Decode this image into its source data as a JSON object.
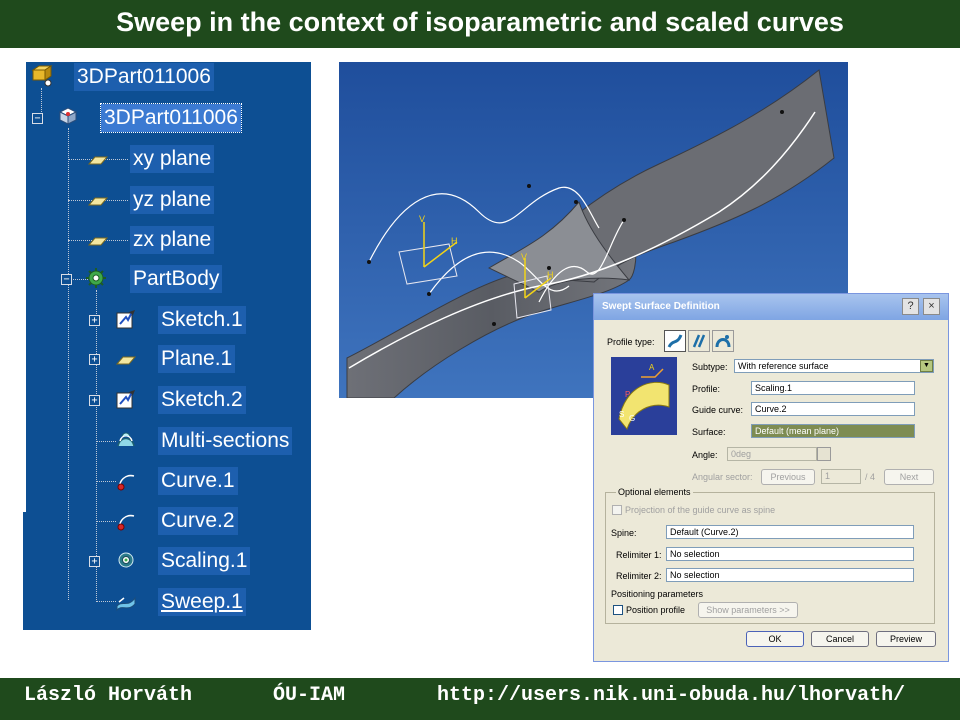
{
  "title": "Sweep in the context of isoparametric and scaled curves",
  "footer": {
    "author": "László Horváth",
    "institute": "ÓU-IAM",
    "url": "http://users.nik.uni-obuda.hu/lhorvath/"
  },
  "tree": {
    "root": "3DPart011006",
    "part": "3DPart011006",
    "xy": "xy plane",
    "yz": "yz plane",
    "zx": "zx plane",
    "body": "PartBody",
    "sketch1": "Sketch.1",
    "plane1": "Plane.1",
    "sketch2": "Sketch.2",
    "multi": "Multi-sections",
    "curve1": "Curve.1",
    "curve2": "Curve.2",
    "scaling1": "Scaling.1",
    "sweep1": "Sweep.1"
  },
  "viewport": {
    "axis_v": "V",
    "axis_h": "H"
  },
  "dialog": {
    "title": "Swept Surface Definition",
    "help_glyph": "?",
    "close_glyph": "×",
    "profile_type_label": "Profile type:",
    "subtype_label": "Subtype:",
    "subtype_value": "With reference surface",
    "profile_label": "Profile:",
    "profile_value": "Scaling.1",
    "guide_label": "Guide curve:",
    "guide_value": "Curve.2",
    "surface_label": "Surface:",
    "surface_value": "Default (mean plane)",
    "angle_label": "Angle:",
    "angle_value": "0deg",
    "sector_label": "Angular sector:",
    "previous": "Previous",
    "sector_value": "1",
    "sector_total": "/ 4",
    "next": "Next",
    "optional_label": "Optional elements",
    "projection_label": "Projection of the guide curve as spine",
    "spine_label": "Spine:",
    "spine_value": "Default (Curve.2)",
    "relim1_label": "Relimiter 1:",
    "relim1_value": "No selection",
    "relim2_label": "Relimiter 2:",
    "relim2_value": "No selection",
    "positioning_label": "Positioning parameters",
    "position_profile": "Position profile",
    "show_params": "Show parameters >>",
    "ok": "OK",
    "cancel": "Cancel",
    "preview": "Preview",
    "preview_letters": {
      "a": "A",
      "p": "P",
      "s": "S",
      "g": "G"
    }
  },
  "colors": {
    "header_green": "#1f4a1c",
    "tree_blue": "#0d4f93",
    "viewport_blue": "#2d5fae",
    "dialog_bg": "#ece9d8"
  }
}
